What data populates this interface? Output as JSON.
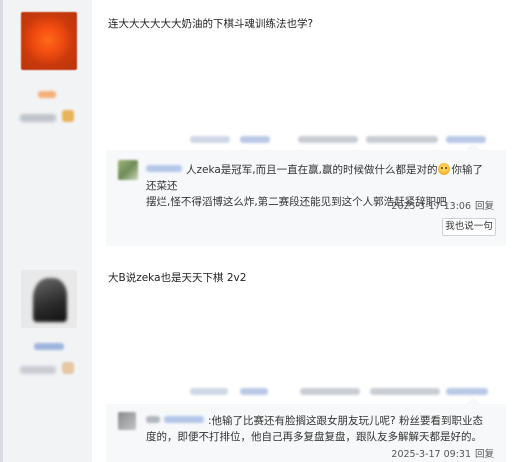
{
  "posts": [
    {
      "content": "连大大大大大大奶油的下棋斗魂训练法也学?",
      "subreply": {
        "text_before": "人zeka是冠军,而且一直在赢,赢的时候做什么都是对的",
        "text_after": "你输了还菜还",
        "text_line2": "摆烂,怪不得滔博这么炸,第二赛段还能见到这个人郭浩赶紧辞职吧",
        "date": "2025-3-17 13:06",
        "reply": "回复"
      },
      "reply_button": "我也说一句"
    },
    {
      "content": "大B说zeka也是天天下棋 2v2",
      "subreply": {
        "text_line1": ":他输了比赛还有脸搁这跟女朋友玩儿呢? 粉丝要看到职业态",
        "text_line2": "度的，即便不打排位，他自己再多复盘复盘，跟队友多解解天都是好的。",
        "date": "2025-3-17 09:31",
        "reply": "回复"
      }
    }
  ],
  "colors": {
    "link_blue": "#2f86d8",
    "sidebar_bg": "#f2f3f5",
    "subreply_bg": "#f7f8fa"
  },
  "icons": {
    "emoji": "surprised-face-emoji"
  }
}
